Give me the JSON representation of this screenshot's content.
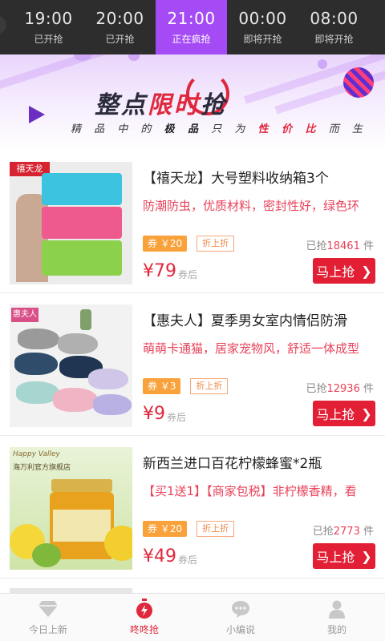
{
  "time_tabs": [
    {
      "time": "19:00",
      "status": "已开抢"
    },
    {
      "time": "20:00",
      "status": "已开抢"
    },
    {
      "time": "21:00",
      "status": "正在疯抢",
      "active": true
    },
    {
      "time": "00:00",
      "status": "即将开抢"
    },
    {
      "time": "08:00",
      "status": "即将开抢"
    }
  ],
  "banner": {
    "title_a": "整点",
    "title_b": "限时",
    "title_c": "抢",
    "subtitle_a": "精 品 中 的",
    "subtitle_b": "极 品",
    "subtitle_c": "只 为",
    "subtitle_d": "性 价 比",
    "subtitle_e": "而 生"
  },
  "products": [
    {
      "title": "【禧天龙】大号塑料收纳箱3个",
      "desc": "防潮防虫，优质材料，密封性好，绿色环",
      "coupon": "券 ￥20",
      "discount": "折上折",
      "sold_prefix": "已抢",
      "sold_count": "18461",
      "sold_unit": "件",
      "price": "¥79",
      "price_note": "券后",
      "buy_label": "马上抢",
      "brand": "禧天龙"
    },
    {
      "title": "【惠夫人】夏季男女室内情侣防滑",
      "desc": "萌萌卡通猫，居家宠物风，舒适一体成型",
      "coupon": "券 ￥3",
      "discount": "折上折",
      "sold_prefix": "已抢",
      "sold_count": "12936",
      "sold_unit": "件",
      "price": "¥9",
      "price_note": "券后",
      "buy_label": "马上抢",
      "brand": "惠夫人"
    },
    {
      "title": "新西兰进口百花柠檬蜂蜜*2瓶",
      "desc": "【买1送1】【商家包税】非柠檬香精，看",
      "coupon": "券 ￥20",
      "discount": "折上折",
      "sold_prefix": "已抢",
      "sold_count": "2773",
      "sold_unit": "件",
      "price": "¥49",
      "price_note": "券后",
      "buy_label": "马上抢",
      "brand": "海万利官方旗舰店",
      "brand_script": "Happy Valley"
    }
  ],
  "bottom_nav": [
    {
      "label": "今日上新",
      "icon": "diamond-icon"
    },
    {
      "label": "咚咚抢",
      "icon": "stopwatch-icon",
      "active": true
    },
    {
      "label": "小编说",
      "icon": "chat-bubble-icon"
    },
    {
      "label": "我的",
      "icon": "person-icon"
    }
  ],
  "colors": {
    "accent_purple": "#a54bf5",
    "accent_red": "#e0283c",
    "coupon_orange": "#f9a23b"
  }
}
